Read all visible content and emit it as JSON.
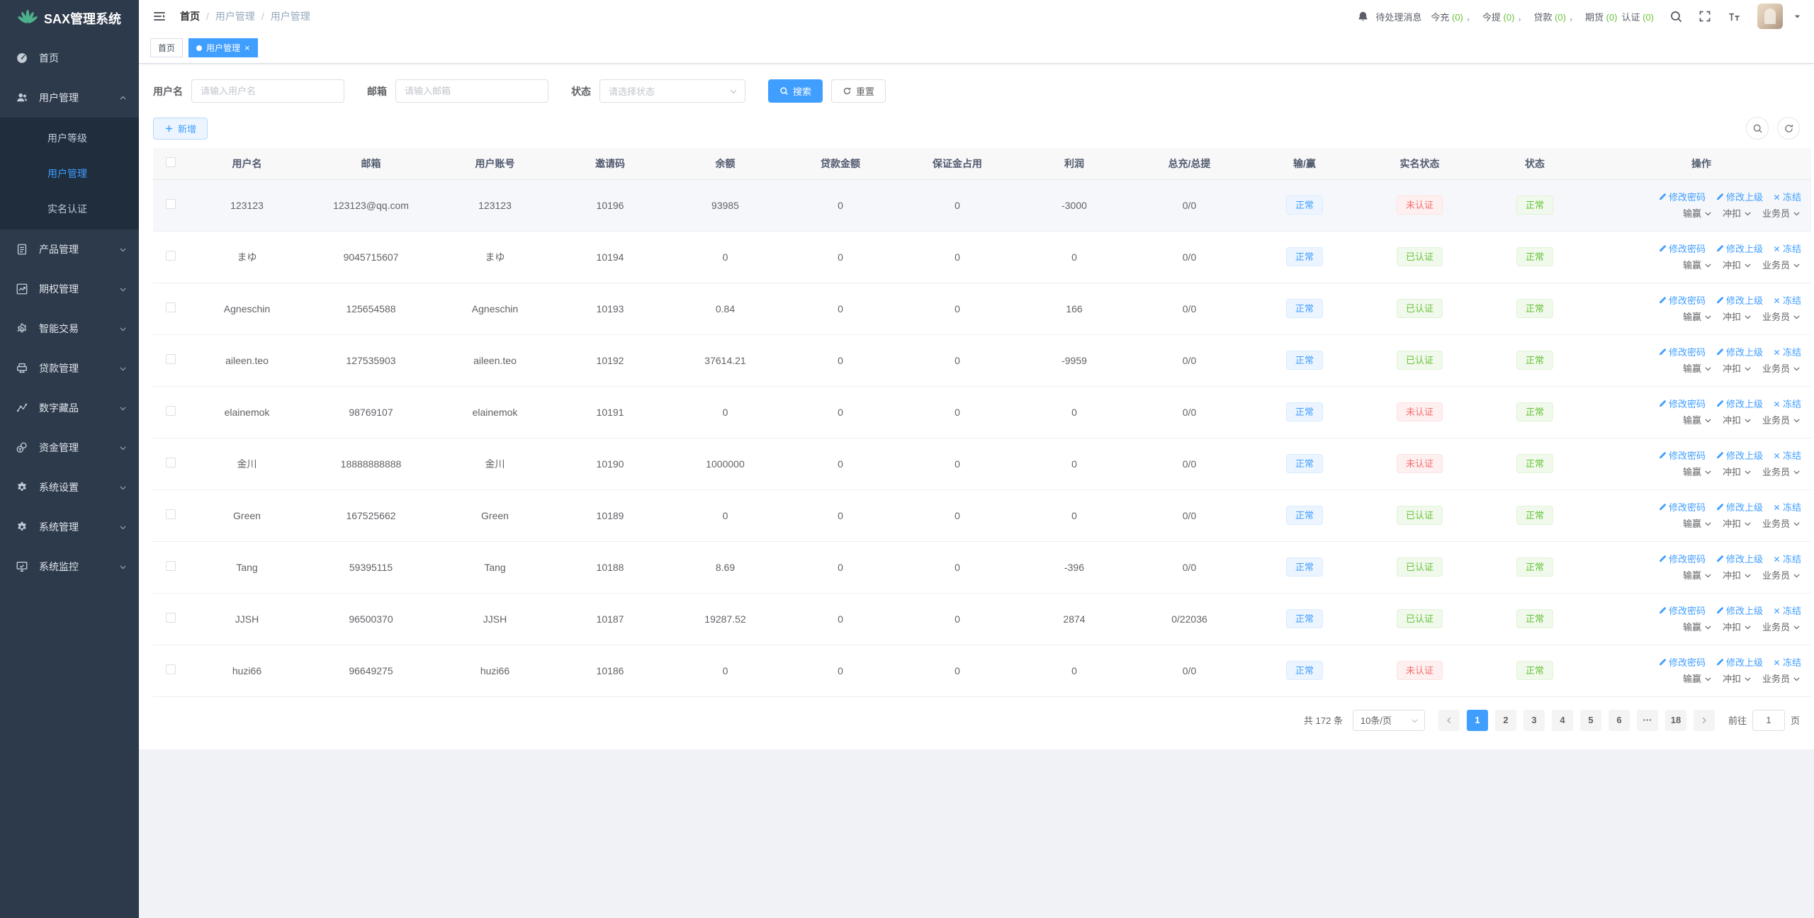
{
  "app": {
    "name": "SAX管理系统"
  },
  "colors": {
    "primary": "#409eff",
    "success": "#67c23a",
    "danger": "#f56c6c",
    "sidebar_bg": "#2d3a4b",
    "submenu_bg": "#1f2d3d"
  },
  "sidebar": {
    "logo_text": "SAX管理系统",
    "items": [
      {
        "name": "home",
        "label": "首页",
        "icon": "dashboard-icon"
      },
      {
        "name": "user-management",
        "label": "用户管理",
        "icon": "users-icon",
        "open": true,
        "children": [
          {
            "name": "user-level",
            "label": "用户等级"
          },
          {
            "name": "user-manage",
            "label": "用户管理",
            "active": true
          },
          {
            "name": "realname-auth",
            "label": "实名认证"
          }
        ]
      },
      {
        "name": "product-management",
        "label": "产品管理",
        "icon": "document-icon",
        "expandable": true
      },
      {
        "name": "options-management",
        "label": "期权管理",
        "icon": "trend-chart-icon",
        "expandable": true
      },
      {
        "name": "smart-trade",
        "label": "智能交易",
        "icon": "gear-outline-icon",
        "expandable": true
      },
      {
        "name": "loan-management",
        "label": "贷款管理",
        "icon": "loan-icon",
        "expandable": true
      },
      {
        "name": "digital-collection",
        "label": "数字藏品",
        "icon": "nft-icon",
        "expandable": true
      },
      {
        "name": "funds-management",
        "label": "资金管理",
        "icon": "funds-icon",
        "expandable": true
      },
      {
        "name": "system-settings",
        "label": "系统设置",
        "icon": "settings-gear-icon",
        "expandable": true
      },
      {
        "name": "system-management",
        "label": "系统管理",
        "icon": "system-gear-icon",
        "expandable": true
      },
      {
        "name": "system-monitor",
        "label": "系统监控",
        "icon": "monitor-icon",
        "expandable": true
      }
    ]
  },
  "topbar": {
    "breadcrumb": [
      "首页",
      "用户管理",
      "用户管理"
    ],
    "notice_prefix": "待处理消息",
    "notices": [
      {
        "label": "今充",
        "count": "(0)",
        "sep": "，"
      },
      {
        "label": "今提",
        "count": "(0)",
        "sep": "，"
      },
      {
        "label": "贷款",
        "count": "(0)",
        "sep": "，"
      },
      {
        "label": "期货",
        "count": "(0)",
        "sep": ""
      },
      {
        "label": "认证",
        "count": "(0)",
        "sep": ""
      }
    ]
  },
  "tabs": [
    {
      "name": "home",
      "label": "首页",
      "active": false
    },
    {
      "name": "user-management",
      "label": "用户管理",
      "active": true,
      "closable": true
    }
  ],
  "filter": {
    "fields": [
      {
        "label": "用户名",
        "placeholder": "请输入用户名",
        "type": "input"
      },
      {
        "label": "邮箱",
        "placeholder": "请输入邮箱",
        "type": "input"
      },
      {
        "label": "状态",
        "placeholder": "请选择状态",
        "type": "select"
      }
    ],
    "search_label": "搜索",
    "reset_label": "重置"
  },
  "toolbar": {
    "add_label": "新增"
  },
  "table": {
    "columns": [
      "用户名",
      "邮箱",
      "用户账号",
      "邀请码",
      "余额",
      "贷款金额",
      "保证金占用",
      "利润",
      "总充/总提",
      "输/赢",
      "实名状态",
      "状态",
      "操作"
    ],
    "rows": [
      {
        "username": "123123",
        "email": "123123@qq.com",
        "account": "123123",
        "invite_code": "10196",
        "balance": "93985",
        "loan": "0",
        "margin": "0",
        "profit": "-3000",
        "totals": "0/0",
        "win_lose": "正常",
        "realname": "未认证",
        "realname_state": "danger",
        "status": "正常"
      },
      {
        "username": "まゆ",
        "email": "9045715607",
        "account": "まゆ",
        "invite_code": "10194",
        "balance": "0",
        "loan": "0",
        "margin": "0",
        "profit": "0",
        "totals": "0/0",
        "win_lose": "正常",
        "realname": "已认证",
        "realname_state": "success",
        "status": "正常"
      },
      {
        "username": "Agneschin",
        "email": "125654588",
        "account": "Agneschin",
        "invite_code": "10193",
        "balance": "0.84",
        "loan": "0",
        "margin": "0",
        "profit": "166",
        "totals": "0/0",
        "win_lose": "正常",
        "realname": "已认证",
        "realname_state": "success",
        "status": "正常"
      },
      {
        "username": "aileen.teo",
        "email": "127535903",
        "account": "aileen.teo",
        "invite_code": "10192",
        "balance": "37614.21",
        "loan": "0",
        "margin": "0",
        "profit": "-9959",
        "totals": "0/0",
        "win_lose": "正常",
        "realname": "已认证",
        "realname_state": "success",
        "status": "正常"
      },
      {
        "username": "elainemok",
        "email": "98769107",
        "account": "elainemok",
        "invite_code": "10191",
        "balance": "0",
        "loan": "0",
        "margin": "0",
        "profit": "0",
        "totals": "0/0",
        "win_lose": "正常",
        "realname": "未认证",
        "realname_state": "danger",
        "status": "正常"
      },
      {
        "username": "金川",
        "email": "18888888888",
        "account": "金川",
        "invite_code": "10190",
        "balance": "1000000",
        "loan": "0",
        "margin": "0",
        "profit": "0",
        "totals": "0/0",
        "win_lose": "正常",
        "realname": "未认证",
        "realname_state": "danger",
        "status": "正常"
      },
      {
        "username": "Green",
        "email": "167525662",
        "account": "Green",
        "invite_code": "10189",
        "balance": "0",
        "loan": "0",
        "margin": "0",
        "profit": "0",
        "totals": "0/0",
        "win_lose": "正常",
        "realname": "已认证",
        "realname_state": "success",
        "status": "正常"
      },
      {
        "username": "Tang",
        "email": "59395115",
        "account": "Tang",
        "invite_code": "10188",
        "balance": "8.69",
        "loan": "0",
        "margin": "0",
        "profit": "-396",
        "totals": "0/0",
        "win_lose": "正常",
        "realname": "已认证",
        "realname_state": "success",
        "status": "正常"
      },
      {
        "username": "JJSH",
        "email": "96500370",
        "account": "JJSH",
        "invite_code": "10187",
        "balance": "19287.52",
        "loan": "0",
        "margin": "0",
        "profit": "2874",
        "totals": "0/22036",
        "win_lose": "正常",
        "realname": "已认证",
        "realname_state": "success",
        "status": "正常"
      },
      {
        "username": "huzi66",
        "email": "96649275",
        "account": "huzi66",
        "invite_code": "10186",
        "balance": "0",
        "loan": "0",
        "margin": "0",
        "profit": "0",
        "totals": "0/0",
        "win_lose": "正常",
        "realname": "未认证",
        "realname_state": "danger",
        "status": "正常"
      }
    ]
  },
  "row_actions": {
    "line1": [
      {
        "name": "edit-password",
        "label": "修改密码",
        "icon": "edit-icon"
      },
      {
        "name": "edit-parent",
        "label": "修改上级",
        "icon": "edit-icon"
      },
      {
        "name": "freeze",
        "label": "冻结",
        "icon": "close-icon"
      }
    ],
    "line2": [
      {
        "name": "winlose",
        "label": "输赢"
      },
      {
        "name": "deduct",
        "label": "冲扣"
      },
      {
        "name": "salesman",
        "label": "业务员"
      }
    ]
  },
  "pagination": {
    "total": "共 172 条",
    "page_size": "10条/页",
    "pages": [
      "1",
      "2",
      "3",
      "4",
      "5",
      "6",
      "···",
      "18"
    ],
    "active": "1",
    "goto_label": "前往",
    "goto_value": "1",
    "goto_suffix": "页"
  }
}
